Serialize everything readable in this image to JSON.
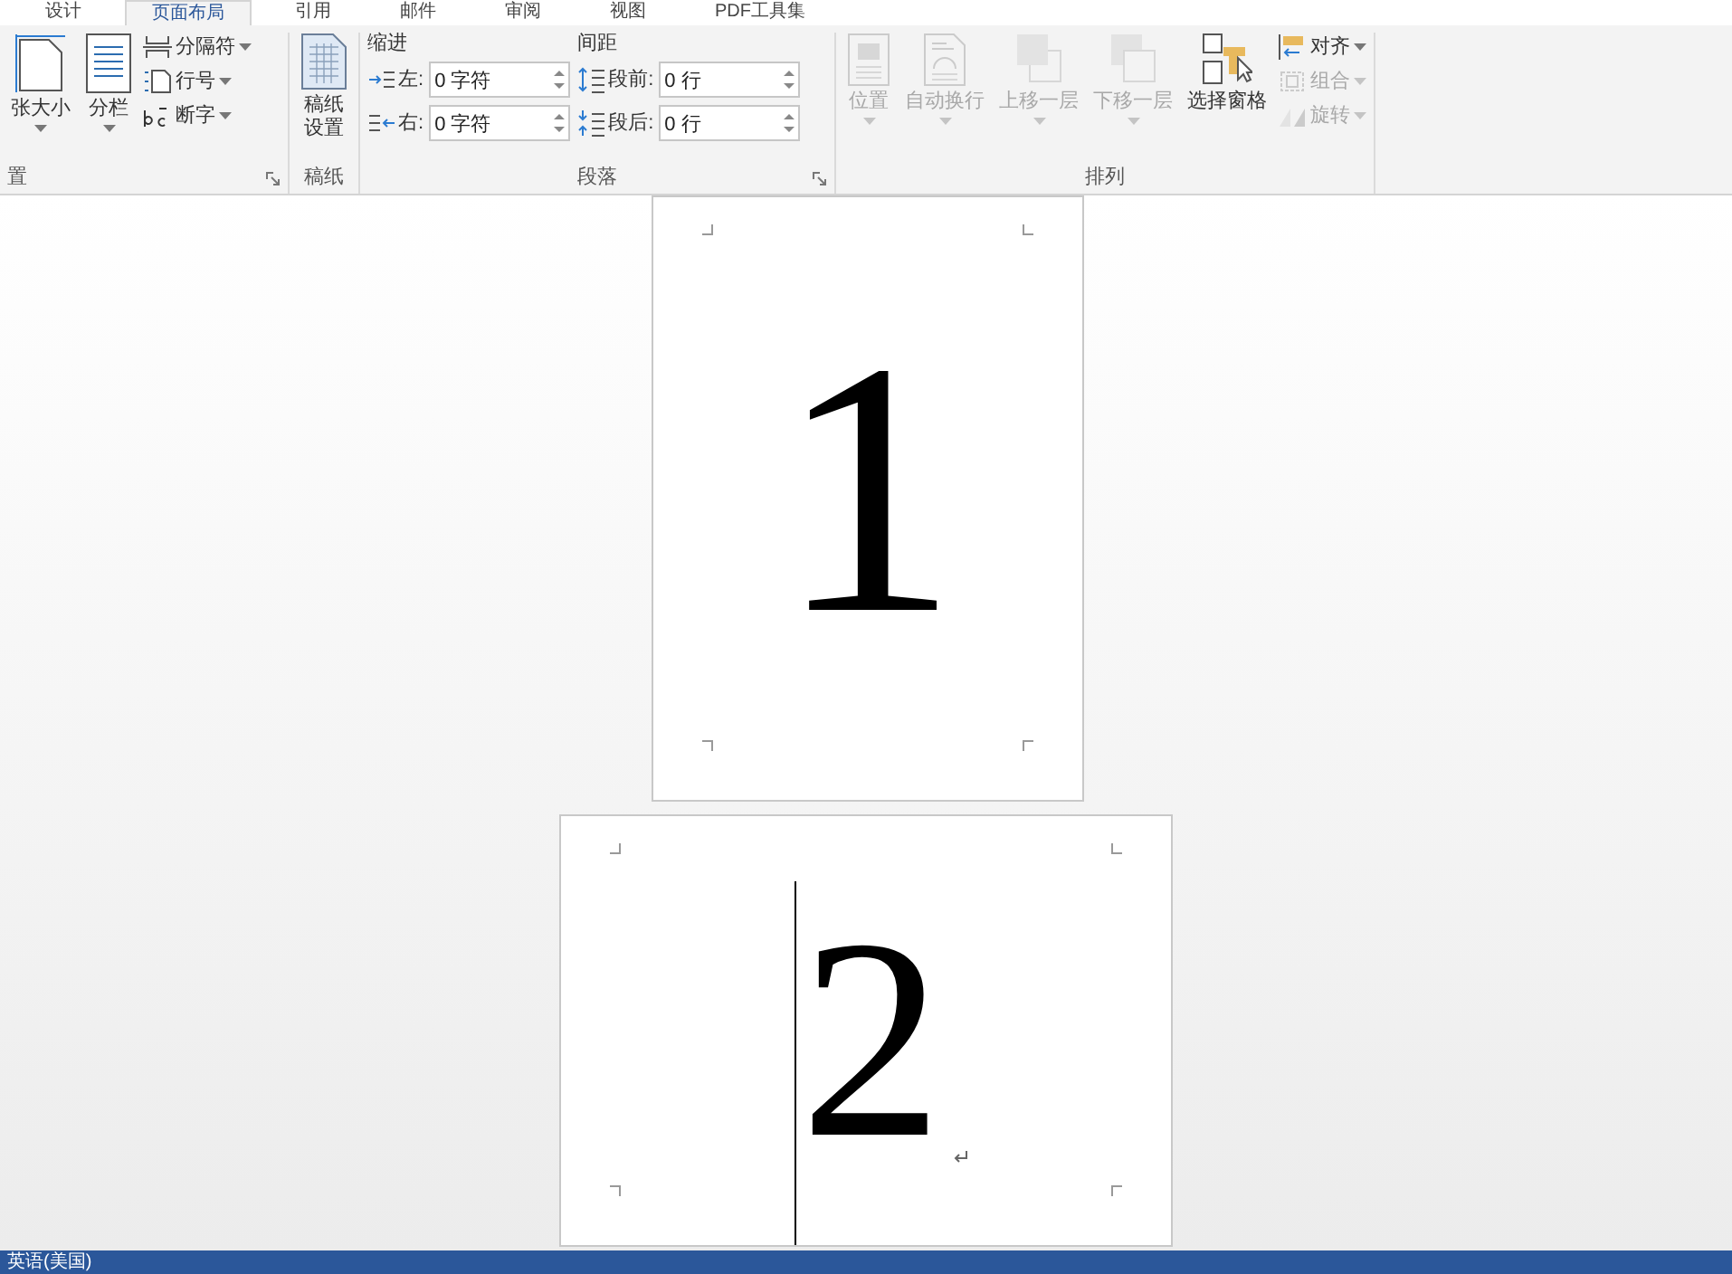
{
  "tabs": [
    {
      "label": "设计",
      "selected": false
    },
    {
      "label": "页面布局",
      "selected": true
    },
    {
      "label": "引用",
      "selected": false
    },
    {
      "label": "邮件",
      "selected": false
    },
    {
      "label": "审阅",
      "selected": false
    },
    {
      "label": "视图",
      "selected": false
    },
    {
      "label": "PDF工具集",
      "selected": false
    }
  ],
  "groups": [
    {
      "label": "置",
      "launcher": true,
      "items": [
        {
          "kind": "large",
          "label": "张大小",
          "dropdown": true,
          "disabled": false
        },
        {
          "kind": "large",
          "label": "分栏",
          "dropdown": true,
          "disabled": false
        },
        {
          "kind": "stack",
          "items": [
            {
              "label": "分隔符",
              "disabled": false
            },
            {
              "label": "行号",
              "disabled": false
            },
            {
              "label": "断字",
              "disabled": false
            }
          ]
        }
      ]
    },
    {
      "label": "稿纸",
      "launcher": false,
      "items": [
        {
          "kind": "large",
          "label": "稿纸设置",
          "dropdown": false,
          "disabled": false
        }
      ]
    },
    {
      "label": "段落",
      "launcher": true,
      "items": [
        {
          "kind": "fields",
          "heading": "缩进",
          "rows": [
            {
              "label": "左:",
              "value": "0 字符"
            },
            {
              "label": "右:",
              "value": "0 字符"
            }
          ]
        },
        {
          "kind": "fields",
          "heading": "间距",
          "rows": [
            {
              "label": "段前:",
              "value": "0 行"
            },
            {
              "label": "段后:",
              "value": "0 行"
            }
          ]
        }
      ]
    },
    {
      "label": "排列",
      "launcher": false,
      "items": [
        {
          "kind": "large",
          "label": "位置",
          "dropdown": true,
          "disabled": true
        },
        {
          "kind": "large",
          "label": "自动换行",
          "dropdown": true,
          "disabled": true
        },
        {
          "kind": "large",
          "label": "上移一层",
          "dropdown": true,
          "disabled": true
        },
        {
          "kind": "large",
          "label": "下移一层",
          "dropdown": true,
          "disabled": true
        },
        {
          "kind": "large",
          "label": "选择窗格",
          "dropdown": false,
          "disabled": false
        },
        {
          "kind": "stack",
          "items": [
            {
              "label": "对齐",
              "disabled": false
            },
            {
              "label": "组合",
              "disabled": true
            },
            {
              "label": "旋转",
              "disabled": true
            }
          ]
        }
      ]
    }
  ],
  "pages": [
    {
      "text": "1",
      "cursor": false,
      "paragraph_mark": false
    },
    {
      "text": "2",
      "cursor": true,
      "paragraph_mark": true
    }
  ],
  "status_bar": {
    "language": "英语(美国)"
  }
}
